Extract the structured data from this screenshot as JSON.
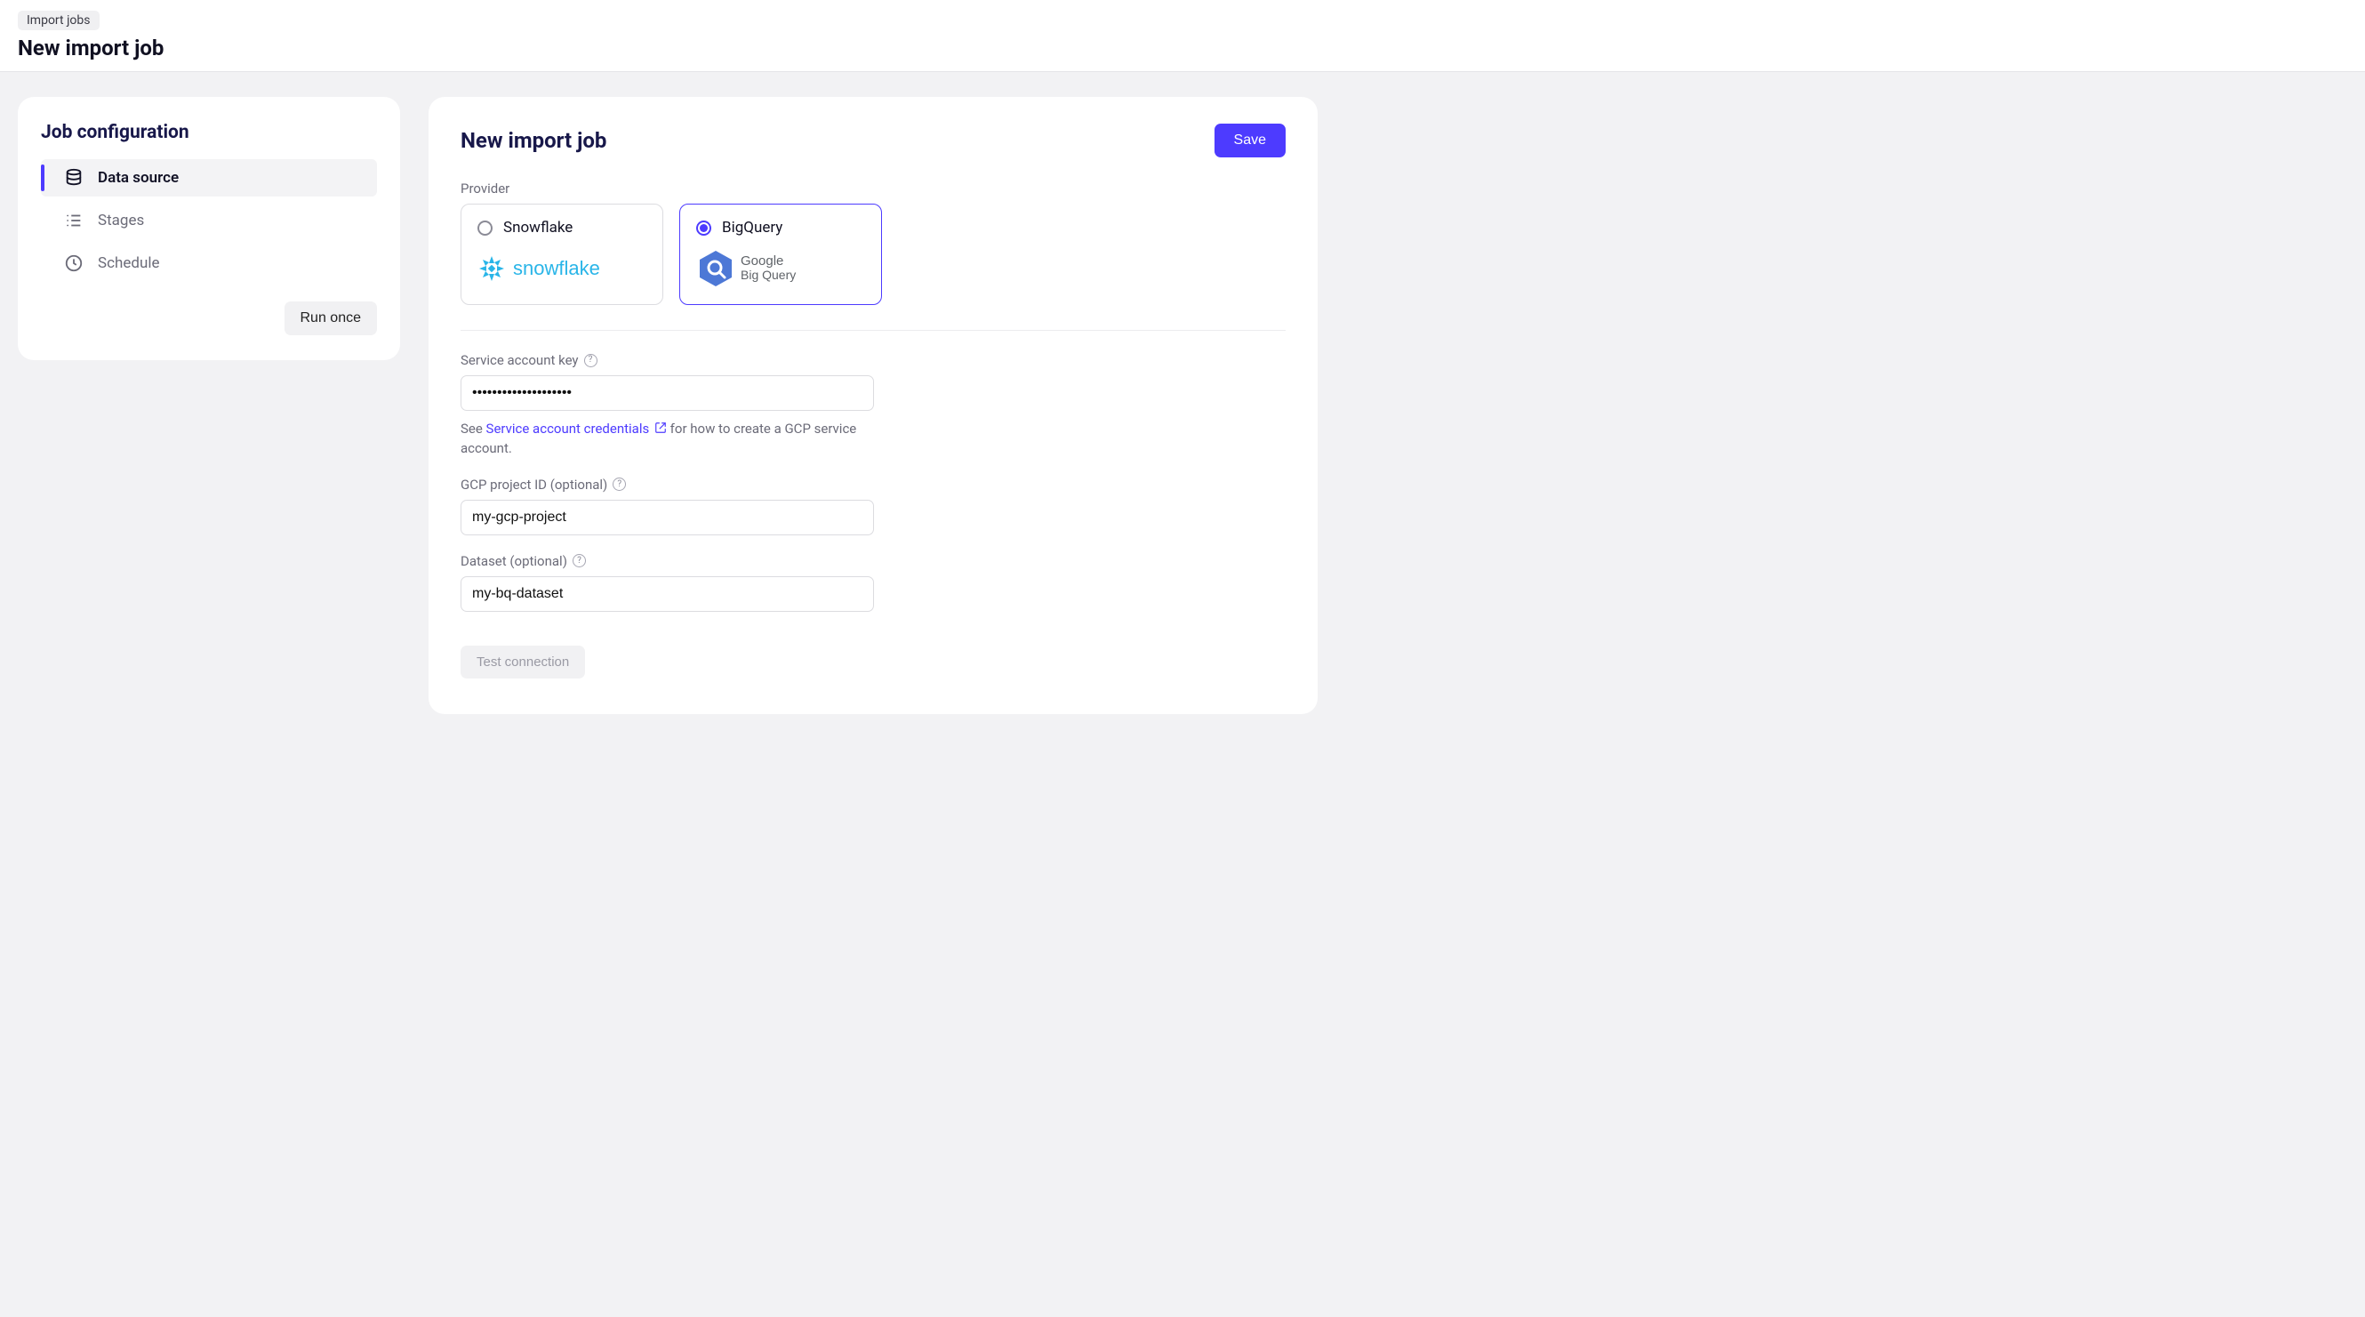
{
  "header": {
    "breadcrumb": "Import jobs",
    "page_title": "New import job"
  },
  "sidebar": {
    "title": "Job configuration",
    "items": [
      {
        "label": "Data source",
        "icon": "database-icon",
        "active": true
      },
      {
        "label": "Stages",
        "icon": "list-icon",
        "active": false
      },
      {
        "label": "Schedule",
        "icon": "clock-icon",
        "active": false
      }
    ],
    "run_once_label": "Run once"
  },
  "main": {
    "title": "New import job",
    "save_label": "Save",
    "provider_label": "Provider",
    "providers": [
      {
        "id": "snowflake",
        "label": "Snowflake",
        "selected": false
      },
      {
        "id": "bigquery",
        "label": "BigQuery",
        "selected": true
      }
    ],
    "service_key": {
      "label": "Service account key",
      "value": "••••••••••••••••••••",
      "hint_prefix": "See ",
      "hint_link": "Service account credentials",
      "hint_suffix": " for how to create a GCP service account."
    },
    "project_id": {
      "label": "GCP project ID (optional)",
      "value": "my-gcp-project"
    },
    "dataset": {
      "label": "Dataset (optional)",
      "value": "my-bq-dataset"
    },
    "test_connection_label": "Test connection"
  }
}
